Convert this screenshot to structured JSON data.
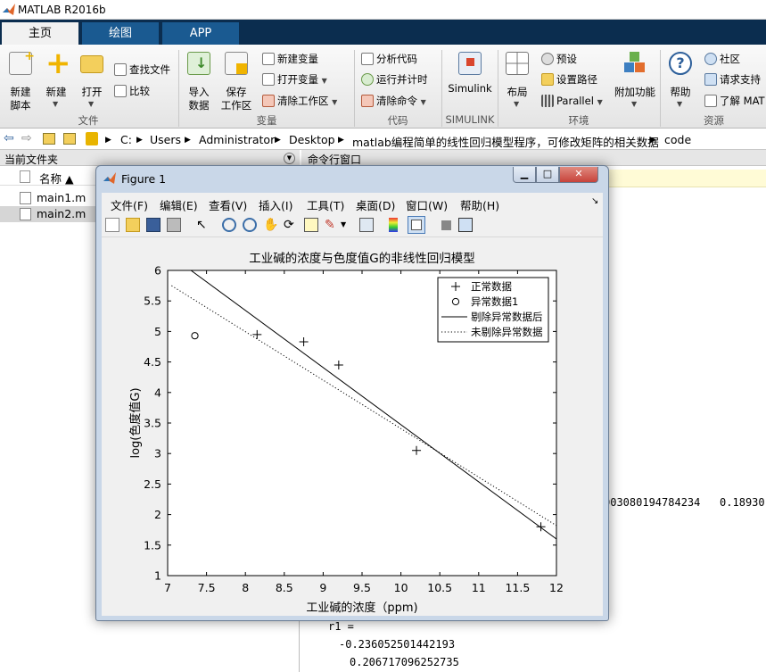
{
  "window": {
    "title": "MATLAB R2016b"
  },
  "tabs": [
    {
      "label": "主页"
    },
    {
      "label": "绘图"
    },
    {
      "label": "APP"
    }
  ],
  "ribbon": {
    "file": {
      "new_script": "新建\n脚本",
      "new": "新建",
      "open": "打开",
      "find_files": "查找文件",
      "compare": "比较",
      "section": "文件"
    },
    "variable": {
      "import": "导入\n数据",
      "save_ws": "保存\n工作区",
      "new_var": "新建变量",
      "open_var": "打开变量",
      "clear_ws": "清除工作区",
      "section": "变量"
    },
    "code": {
      "analyze": "分析代码",
      "run_time": "运行并计时",
      "clear_cmd": "清除命令",
      "section": "代码"
    },
    "simulink": {
      "label": "Simulink",
      "section": "SIMULINK"
    },
    "env": {
      "layout": "布局",
      "prefs": "预设",
      "set_path": "设置路径",
      "parallel": "Parallel",
      "addons": "附加功能",
      "section": "环境"
    },
    "resources": {
      "help": "帮助",
      "community": "社区",
      "support": "请求支持",
      "learn": "了解 MAT",
      "section": "资源"
    }
  },
  "address": {
    "crumbs": [
      "C:",
      "Users",
      "Administrator",
      "Desktop",
      "matlab编程简单的线性回归模型程序，可修改矩阵的相关数据",
      "code"
    ]
  },
  "current_folder": {
    "title": "当前文件夹",
    "col_name": "名称 ▲",
    "files": [
      {
        "name": "main1.m"
      },
      {
        "name": "main2.m"
      }
    ]
  },
  "command_window": {
    "title": "命令行窗口",
    "line1": "003080194784234   0.18930",
    "r1_label": "r1 =",
    "r1_val1": "-0.236052501442193",
    "r1_val2": "0.206717096252735"
  },
  "figure": {
    "title": "Figure 1",
    "menus": [
      "文件(F)",
      "编辑(E)",
      "查看(V)",
      "插入(I)",
      "工具(T)",
      "桌面(D)",
      "窗口(W)",
      "帮助(H)"
    ],
    "colors": {
      "titlebar": "#c9d7e8",
      "close": "#c7433b",
      "axes": "#ffffff"
    },
    "icons": [
      "new-figure-icon",
      "open-icon",
      "save-icon",
      "print-icon",
      "pointer-icon",
      "zoom-in-icon",
      "zoom-out-icon",
      "pan-icon",
      "rotate-icon",
      "data-cursor-icon",
      "brush-icon",
      "link-icon",
      "colorbar-icon",
      "legend-icon",
      "hide-tools-icon",
      "dock-icon"
    ]
  },
  "chart_data": {
    "type": "line",
    "title": "工业碱的浓度与色度值G的非线性回归模型",
    "xlabel": "工业碱的浓度（ppm)",
    "ylabel": "log(色度值G)",
    "xlim": [
      7,
      12
    ],
    "ylim": [
      1,
      6
    ],
    "xticks": [
      7,
      7.5,
      8,
      8.5,
      9,
      9.5,
      10,
      10.5,
      11,
      11.5,
      12
    ],
    "yticks": [
      1,
      1.5,
      2,
      2.5,
      3,
      3.5,
      4,
      4.5,
      5,
      5.5,
      6
    ],
    "legend_position": "top-right",
    "series": [
      {
        "name": "正常数据",
        "kind": "marker-plus",
        "x": [
          8.15,
          8.75,
          9.2,
          10.2,
          11.8
        ],
        "y": [
          4.95,
          4.83,
          4.45,
          3.05,
          1.8
        ]
      },
      {
        "name": "异常数据1",
        "kind": "marker-circle",
        "x": [
          7.35
        ],
        "y": [
          4.93
        ]
      },
      {
        "name": "剔除异常数据后",
        "kind": "solid",
        "x": [
          7.3,
          12
        ],
        "y": [
          6.0,
          1.6
        ]
      },
      {
        "name": "未剔除异常数据",
        "kind": "dotted",
        "x": [
          7.05,
          12
        ],
        "y": [
          5.75,
          1.82
        ]
      }
    ]
  }
}
